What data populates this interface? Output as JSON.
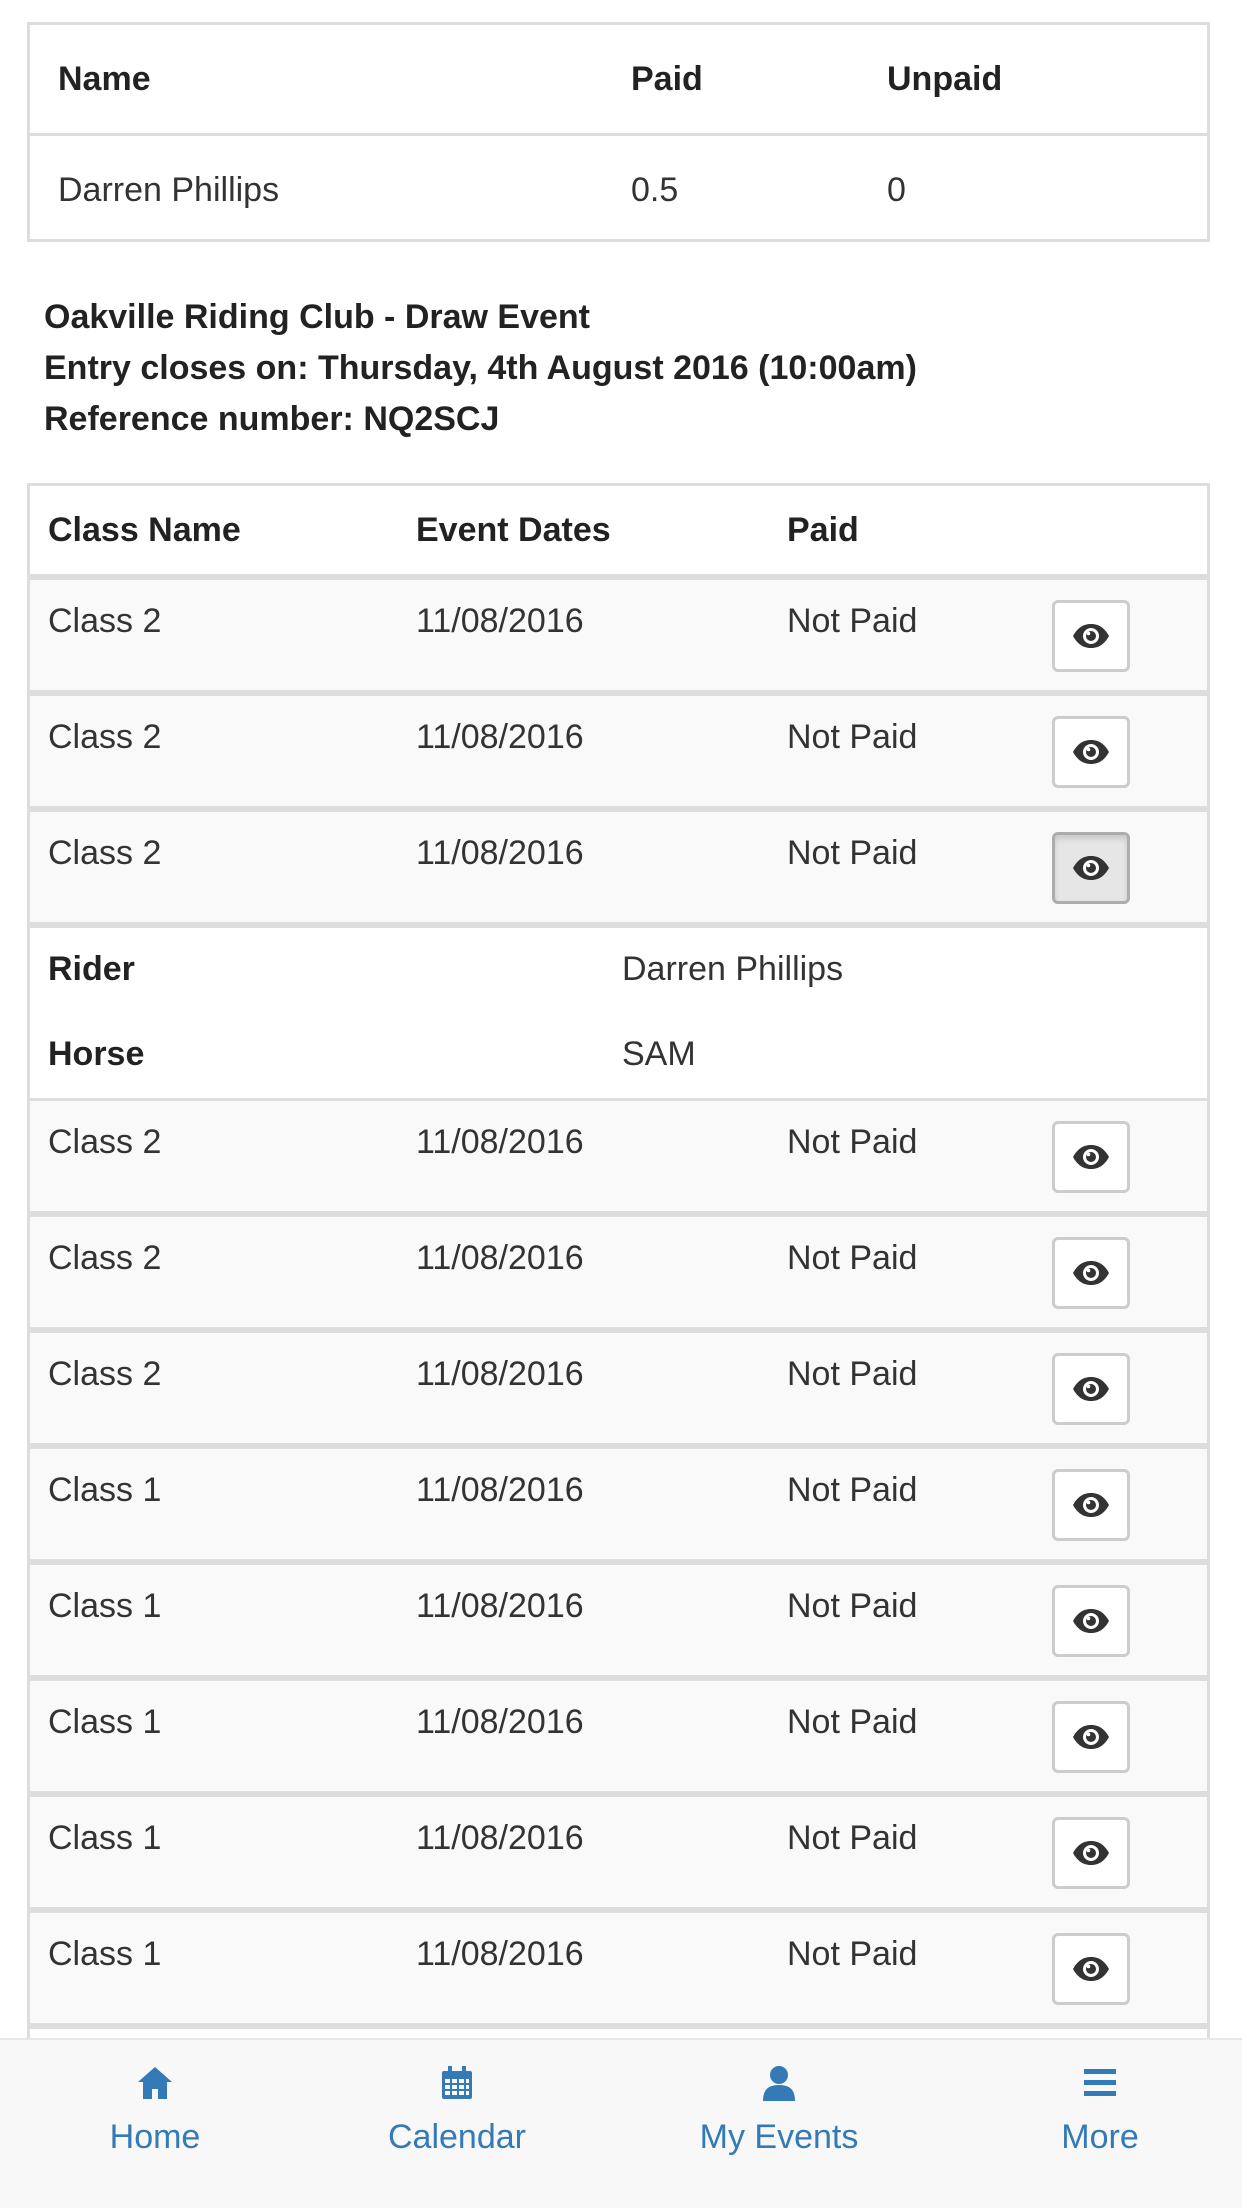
{
  "colors": {
    "accent": "#337ab7",
    "border": "#dddddd",
    "row_stripe": "#f9f9f9",
    "nav_background": "#f8f8f8"
  },
  "summary": {
    "headers": {
      "name": "Name",
      "paid": "Paid",
      "unpaid": "Unpaid"
    },
    "row": {
      "name": "Darren Phillips",
      "paid": "0.5",
      "unpaid": "0"
    }
  },
  "event": {
    "title": "Oakville Riding Club - Draw Event",
    "closes": "Entry closes on: Thursday, 4th August 2016 (10:00am)",
    "reference": "Reference number: NQ2SCJ"
  },
  "classes": {
    "headers": {
      "class_name": "Class Name",
      "event_dates": "Event Dates",
      "paid": "Paid"
    },
    "view_icon": "eye-icon",
    "rows": [
      {
        "class_name": "Class 2",
        "date": "11/08/2016",
        "paid": "Not Paid"
      },
      {
        "class_name": "Class 2",
        "date": "11/08/2016",
        "paid": "Not Paid"
      },
      {
        "class_name": "Class 2",
        "date": "11/08/2016",
        "paid": "Not Paid"
      },
      {
        "class_name": "Class 2",
        "date": "11/08/2016",
        "paid": "Not Paid"
      },
      {
        "class_name": "Class 2",
        "date": "11/08/2016",
        "paid": "Not Paid"
      },
      {
        "class_name": "Class 2",
        "date": "11/08/2016",
        "paid": "Not Paid"
      },
      {
        "class_name": "Class 1",
        "date": "11/08/2016",
        "paid": "Not Paid"
      },
      {
        "class_name": "Class 1",
        "date": "11/08/2016",
        "paid": "Not Paid"
      },
      {
        "class_name": "Class 1",
        "date": "11/08/2016",
        "paid": "Not Paid"
      },
      {
        "class_name": "Class 1",
        "date": "11/08/2016",
        "paid": "Not Paid"
      },
      {
        "class_name": "Class 1",
        "date": "11/08/2016",
        "paid": "Not Paid"
      }
    ],
    "detail": {
      "rider_label": "Rider",
      "rider_value": "Darren Phillips",
      "horse_label": "Horse",
      "horse_value": "SAM"
    }
  },
  "nav": {
    "items": [
      {
        "label": "Home",
        "icon": "home-icon"
      },
      {
        "label": "Calendar",
        "icon": "calendar-icon"
      },
      {
        "label": "My Events",
        "icon": "user-icon"
      },
      {
        "label": "More",
        "icon": "menu-icon"
      }
    ]
  }
}
